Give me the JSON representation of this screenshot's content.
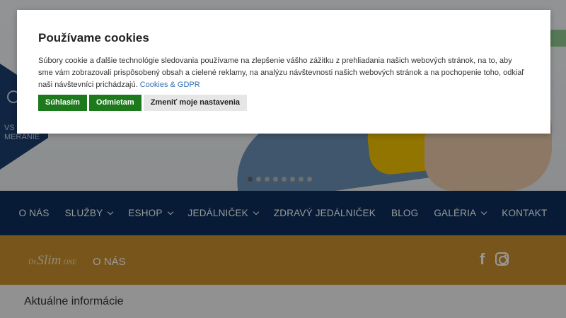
{
  "hero": {
    "side_badge_text": "VS\nMERANIE",
    "slider_dots": 8,
    "active_dot": 0
  },
  "nav": {
    "items": [
      {
        "label": "O NÁS",
        "dropdown": false
      },
      {
        "label": "SLUŽBY",
        "dropdown": true
      },
      {
        "label": "ESHOP",
        "dropdown": true
      },
      {
        "label": "JEDÁLNIČEK",
        "dropdown": true
      },
      {
        "label": "ZDRAVÝ JEDÁLNIČEK",
        "dropdown": false
      },
      {
        "label": "BLOG",
        "dropdown": false
      },
      {
        "label": "GALÉRIA",
        "dropdown": true
      },
      {
        "label": "KONTAKT",
        "dropdown": false
      }
    ]
  },
  "sub_bar": {
    "logo_dr": "Dr.",
    "logo_slim": "Slim",
    "logo_suffix": "ONE",
    "title": "O NÁS",
    "social": [
      "facebook-icon",
      "instagram-icon"
    ]
  },
  "content": {
    "section_title": "Aktuálne informácie"
  },
  "cookie": {
    "title": "Používame cookies",
    "text": "Súbory cookie a ďalšie technológie sledovania používame na zlepšenie vášho zážitku z prehliadania našich webových stránok, na to, aby sme vám zobrazovali prispôsobený obsah a cielené reklamy, na analýzu návštevnosti našich webových stránok a na pochopenie toho, odkiaľ naši návštevníci prichádzajú.",
    "link_label": "Cookies & GDPR",
    "accept_label": "Súhlasím",
    "reject_label": "Odmietam",
    "settings_label": "Zmeniť moje nastavenia"
  },
  "colors": {
    "nav_bg": "#0c2d5a",
    "sub_bar_bg": "#c98f2d",
    "button_green": "#1c7a1c",
    "link_blue": "#2f6fb8"
  }
}
